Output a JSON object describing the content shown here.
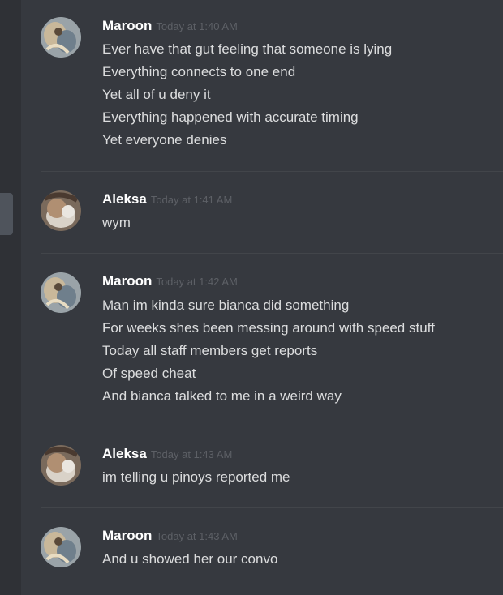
{
  "colors": {
    "background": "#36393f",
    "rail": "#2f3136",
    "username": "#ffffff",
    "timestamp": "#5d6066",
    "message_text": "#dcddde"
  },
  "messages": [
    {
      "author": "Maroon",
      "time": "Today at 1:40 AM",
      "avatar": "maroon-avatar",
      "lines": [
        "Ever have that gut feeling that someone is lying",
        "Everything connects to one end",
        "Yet all of u deny it",
        "Everything happened with accurate timing",
        "Yet everyone denies"
      ]
    },
    {
      "author": "Aleksa",
      "time": "Today at 1:41 AM",
      "avatar": "aleksa-avatar",
      "lines": [
        "wym"
      ]
    },
    {
      "author": "Maroon",
      "time": "Today at 1:42 AM",
      "avatar": "maroon-avatar",
      "lines": [
        "Man im kinda sure bianca did something",
        "For weeks shes  been messing around with speed stuff",
        "Today all staff members get reports",
        "Of speed cheat",
        "And bianca talked to me in a weird way"
      ]
    },
    {
      "author": "Aleksa",
      "time": "Today at 1:43 AM",
      "avatar": "aleksa-avatar",
      "lines": [
        "im telling u pinoys reported me"
      ]
    },
    {
      "author": "Maroon",
      "time": "Today at 1:43 AM",
      "avatar": "maroon-avatar",
      "lines": [
        "And u showed her our convo"
      ]
    }
  ]
}
